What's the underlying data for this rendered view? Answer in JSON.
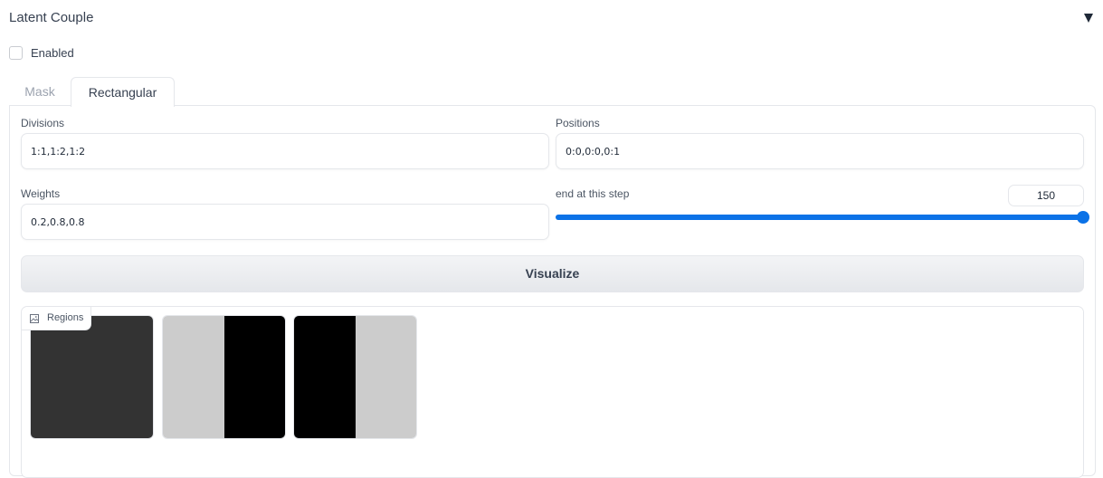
{
  "accordion": {
    "title": "Latent Couple",
    "collapse_icon": "triangle-down-icon"
  },
  "enabled": {
    "label": "Enabled",
    "checked": false
  },
  "tabs": [
    {
      "label": "Mask",
      "selected": false
    },
    {
      "label": "Rectangular",
      "selected": true
    }
  ],
  "fields": {
    "divisions": {
      "label": "Divisions",
      "value": "1:1,1:2,1:2"
    },
    "positions": {
      "label": "Positions",
      "value": "0:0,0:0,0:1"
    },
    "weights": {
      "label": "Weights",
      "value": "0.2,0.8,0.8"
    },
    "end_step": {
      "label": "end at this step",
      "value": "150",
      "fraction": 1.0
    }
  },
  "visualize_button": {
    "label": "Visualize"
  },
  "gallery": {
    "label": "Regions",
    "label_icon": "image-icon",
    "thumbnails": [
      {
        "left_color": "#333333",
        "right_color": "#333333"
      },
      {
        "left_color": "#cccccc",
        "right_color": "#000000"
      },
      {
        "left_color": "#000000",
        "right_color": "#cccccc"
      }
    ]
  },
  "colors": {
    "accent": "#0b72e7",
    "border": "#e5e7eb"
  }
}
